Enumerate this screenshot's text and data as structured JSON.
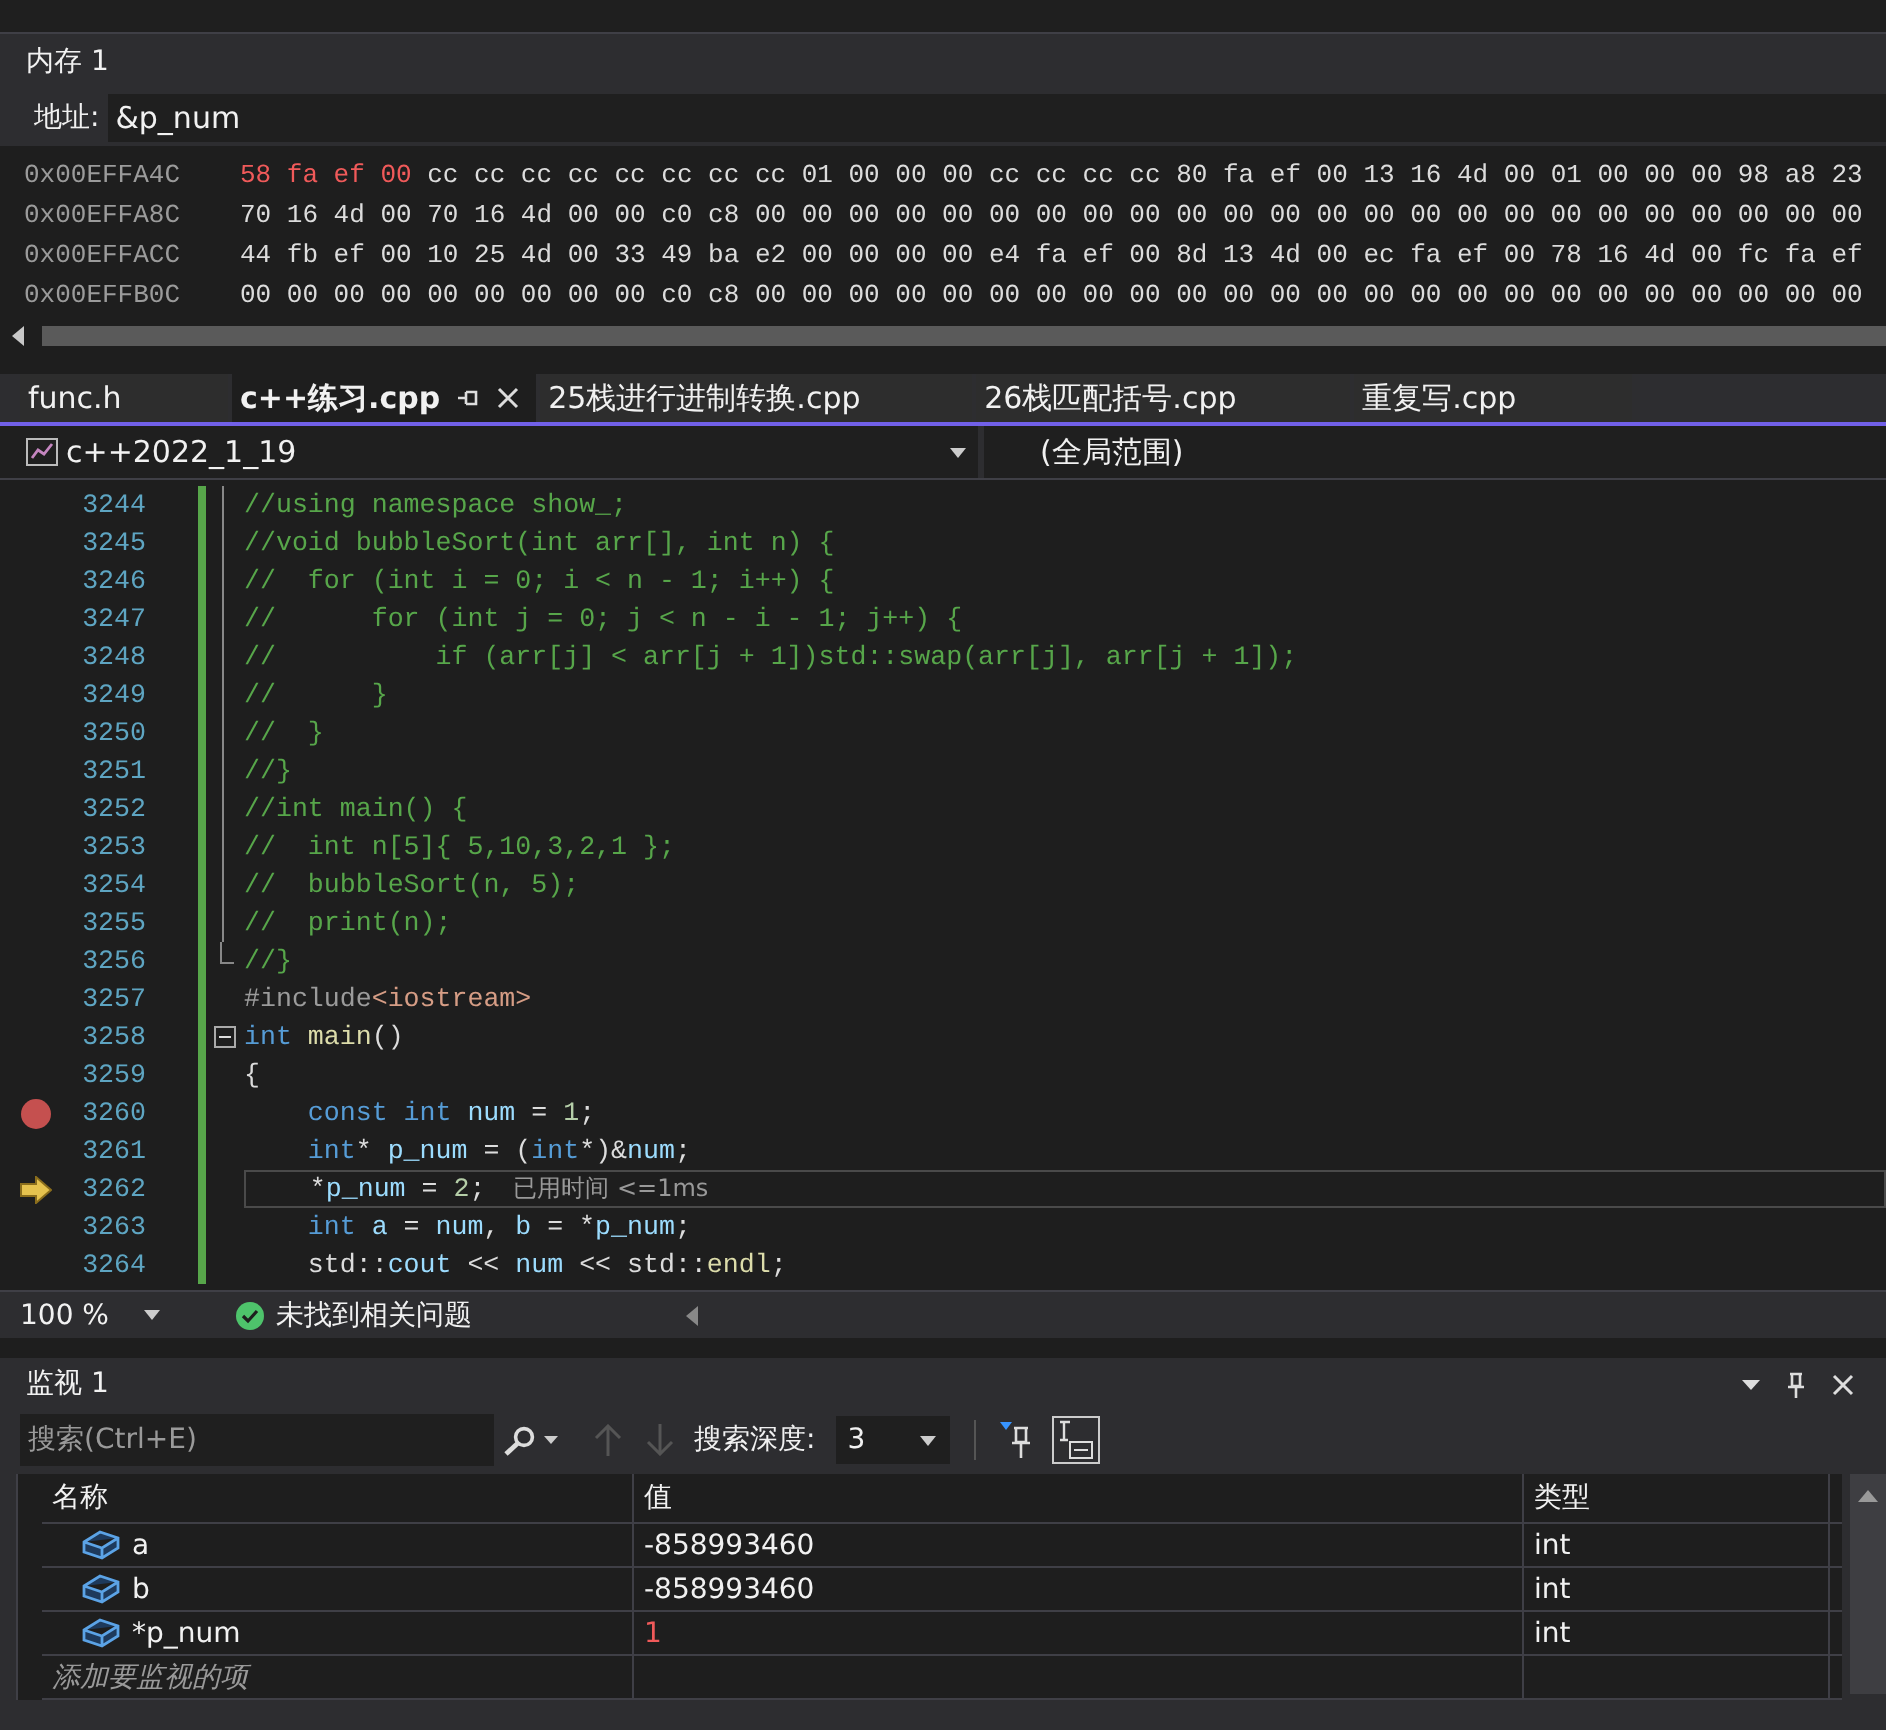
{
  "memory_window": {
    "title": "内存 1",
    "address_label": "地址:",
    "address_value": "&p_num",
    "rows": [
      {
        "address": "0x00EFFA4C",
        "changed_bytes": "58 fa ef 00",
        "bytes": "cc cc cc cc cc cc cc cc 01 00 00 00 cc cc cc cc 80 fa ef 00 13 16 4d 00 01 00 00 00 98 a8 23"
      },
      {
        "address": "0x00EFFA8C",
        "bytes": "70 16 4d 00 70 16 4d 00 00 c0 c8 00 00 00 00 00 00 00 00 00 00 00 00 00 00 00 00 00 00 00 00 00 00 00 00"
      },
      {
        "address": "0x00EFFACC",
        "bytes": "44 fb ef 00 10 25 4d 00 33 49 ba e2 00 00 00 00 e4 fa ef 00 8d 13 4d 00 ec fa ef 00 78 16 4d 00 fc fa ef"
      },
      {
        "address": "0x00EFFB0C",
        "bytes": "00 00 00 00 00 00 00 00 00 c0 c8 00 00 00 00 00 00 00 00 00 00 00 00 00 00 00 00 00 00 00 00 00 00 00 00"
      }
    ]
  },
  "tabs": [
    {
      "label": "func.h",
      "selected": false
    },
    {
      "label": "c++练习.cpp",
      "selected": true
    },
    {
      "label": "25栈进行进制转换.cpp",
      "selected": false
    },
    {
      "label": "26栈匹配括号.cpp",
      "selected": false
    },
    {
      "label": "重复写.cpp",
      "selected": false
    }
  ],
  "navigation": {
    "project": "c++2022_1_19",
    "scope": "(全局范围)"
  },
  "code_lines": [
    {
      "number": "3244",
      "in_fold": true,
      "tokens": [
        {
          "text": "//using namespace show_;",
          "kind": "comment"
        }
      ]
    },
    {
      "number": "3245",
      "in_fold": true,
      "tokens": [
        {
          "text": "//void bubbleSort(int arr[], int n) {",
          "kind": "comment"
        }
      ]
    },
    {
      "number": "3246",
      "in_fold": true,
      "tokens": [
        {
          "text": "//  for (int i = 0; i < n - 1; i++) {",
          "kind": "comment"
        }
      ]
    },
    {
      "number": "3247",
      "in_fold": true,
      "tokens": [
        {
          "text": "//      for (int j = 0; j < n - i - 1; j++) {",
          "kind": "comment"
        }
      ]
    },
    {
      "number": "3248",
      "in_fold": true,
      "tokens": [
        {
          "text": "//          if (arr[j] < arr[j + 1])std::swap(arr[j], arr[j + 1]);",
          "kind": "comment"
        }
      ]
    },
    {
      "number": "3249",
      "in_fold": true,
      "tokens": [
        {
          "text": "//      }",
          "kind": "comment"
        }
      ]
    },
    {
      "number": "3250",
      "in_fold": true,
      "tokens": [
        {
          "text": "//  }",
          "kind": "comment"
        }
      ]
    },
    {
      "number": "3251",
      "in_fold": true,
      "tokens": [
        {
          "text": "//}",
          "kind": "comment"
        }
      ]
    },
    {
      "number": "3252",
      "in_fold": true,
      "tokens": [
        {
          "text": "//int main() {",
          "kind": "comment"
        }
      ]
    },
    {
      "number": "3253",
      "in_fold": true,
      "tokens": [
        {
          "text": "//  int n[5]{ 5,10,3,2,1 };",
          "kind": "comment"
        }
      ]
    },
    {
      "number": "3254",
      "in_fold": true,
      "tokens": [
        {
          "text": "//  bubbleSort(n, 5);",
          "kind": "comment"
        }
      ]
    },
    {
      "number": "3255",
      "in_fold": true,
      "tokens": [
        {
          "text": "//  print(n);",
          "kind": "comment"
        }
      ]
    },
    {
      "number": "3256",
      "fold_end": true,
      "tokens": [
        {
          "text": "//}",
          "kind": "comment"
        }
      ]
    },
    {
      "number": "3257",
      "tokens": [
        {
          "text": "#include",
          "kind": "preprocessor"
        },
        {
          "text": "<iostream>",
          "kind": "string_glued"
        }
      ]
    },
    {
      "number": "3258",
      "collapsible": true,
      "tokens": [
        {
          "text": "int",
          "kind": "keyword"
        },
        {
          "text": "main",
          "kind": "function"
        },
        {
          "text": "()",
          "kind": "glued"
        }
      ]
    },
    {
      "number": "3259",
      "tokens": [
        {
          "text": "{",
          "kind": "plain"
        }
      ]
    },
    {
      "number": "3260",
      "indented": true,
      "breakpoint": true,
      "tokens": [
        {
          "text": "const",
          "kind": "keyword"
        },
        {
          "text": "int",
          "kind": "keyword"
        },
        {
          "text": "num",
          "kind": "variable"
        },
        {
          "text": "=",
          "kind": "plain"
        },
        {
          "text": "1",
          "kind": "number"
        },
        {
          "text": ";",
          "kind": "glued"
        }
      ]
    },
    {
      "number": "3261",
      "indented": true,
      "tokens": [
        {
          "text": "int",
          "kind": "keyword"
        },
        {
          "text": "*",
          "kind": "glued"
        },
        {
          "text": "p_num",
          "kind": "variable"
        },
        {
          "text": "= (",
          "kind": "plain"
        },
        {
          "text": "int",
          "kind": "keyword_glued"
        },
        {
          "text": "*)&",
          "kind": "glued"
        },
        {
          "text": "num",
          "kind": "variable_glued"
        },
        {
          "text": ";",
          "kind": "glued"
        }
      ]
    },
    {
      "number": "3262",
      "indented": true,
      "current": true,
      "hint": "已用时间 <=1ms",
      "tokens": [
        {
          "text": "*",
          "kind": "plain"
        },
        {
          "text": "p_num",
          "kind": "variable_glued"
        },
        {
          "text": "=",
          "kind": "plain"
        },
        {
          "text": "2",
          "kind": "number"
        },
        {
          "text": ";",
          "kind": "glued"
        }
      ]
    },
    {
      "number": "3263",
      "indented": true,
      "tokens": [
        {
          "text": "int",
          "kind": "keyword"
        },
        {
          "text": "a",
          "kind": "variable"
        },
        {
          "text": "=",
          "kind": "plain"
        },
        {
          "text": "num",
          "kind": "variable"
        },
        {
          "text": ",",
          "kind": "glued"
        },
        {
          "text": "b",
          "kind": "variable"
        },
        {
          "text": "= *",
          "kind": "plain"
        },
        {
          "text": "p_num",
          "kind": "variable_glued"
        },
        {
          "text": ";",
          "kind": "glued"
        }
      ]
    },
    {
      "number": "3264",
      "indented": true,
      "tokens": [
        {
          "text": "std::",
          "kind": "plain"
        },
        {
          "text": "cout",
          "kind": "variable_glued"
        },
        {
          "text": "<<",
          "kind": "plain"
        },
        {
          "text": "num",
          "kind": "variable"
        },
        {
          "text": "<< std::",
          "kind": "plain"
        },
        {
          "text": "endl",
          "kind": "function_glued"
        },
        {
          "text": ";",
          "kind": "glued"
        }
      ]
    }
  ],
  "status_bar": {
    "zoom": "100 %",
    "issues": "未找到相关问题"
  },
  "watch_window": {
    "title": "监视 1",
    "search_placeholder": "搜索(Ctrl+E)",
    "depth_label": "搜索深度:",
    "depth": "3",
    "columns": [
      "名称",
      "值",
      "类型"
    ],
    "rows": [
      {
        "name": "a",
        "value": "-858993460",
        "type": "int",
        "changed": false
      },
      {
        "name": "b",
        "value": "-858993460",
        "type": "int",
        "changed": false
      },
      {
        "name": "*p_num",
        "value": "1",
        "type": "int",
        "changed": true
      }
    ],
    "add_placeholder": "添加要监视的项"
  }
}
